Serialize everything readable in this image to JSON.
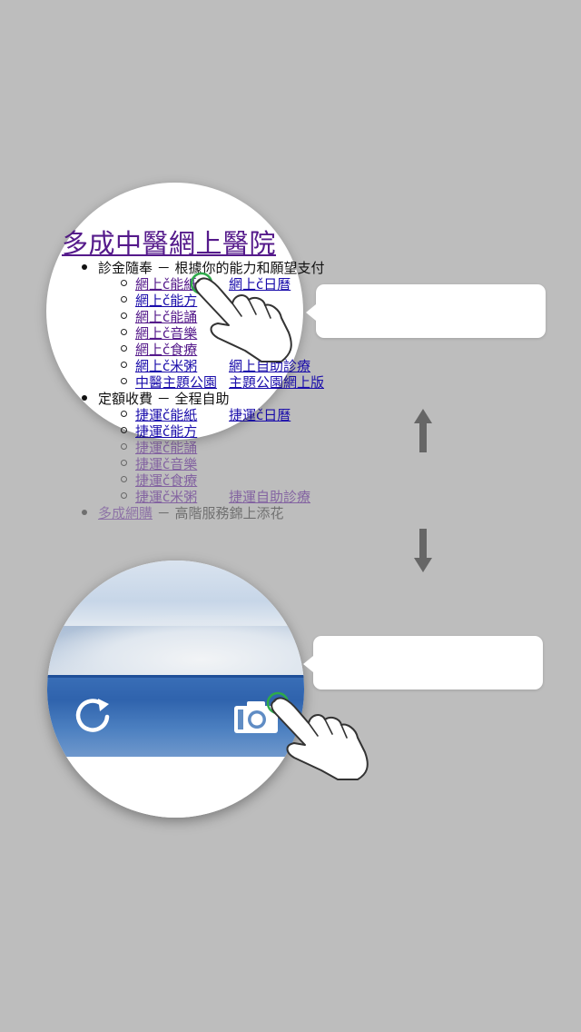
{
  "site": {
    "title": "多成中醫網上醫院"
  },
  "sections": [
    {
      "label": "診金隨奉 － 根據你的能力和願望支付",
      "rows": [
        {
          "left": "網上č能紙",
          "right": "網上č日曆"
        },
        {
          "left": "網上č能方",
          "right": ""
        },
        {
          "left": "網上č能誦",
          "right": ""
        },
        {
          "left": "網上č音樂",
          "right": ""
        },
        {
          "left": "網上č食療",
          "right": ""
        },
        {
          "left": "網上č米粥",
          "right": "網上自助診療"
        },
        {
          "left": "中醫主題公園",
          "right": "主題公園網上版"
        }
      ]
    },
    {
      "label": "定額收費 － 全程自助",
      "rows": [
        {
          "left": "捷運č能紙",
          "right": "捷運č日曆"
        },
        {
          "left": "捷運č能方",
          "right": ""
        },
        {
          "left": "捷運č能誦",
          "right": ""
        },
        {
          "left": "捷運č音樂",
          "right": ""
        },
        {
          "left": "捷運č食療",
          "right": ""
        },
        {
          "left": "捷運č米粥",
          "right": "捷運自助診療"
        }
      ]
    }
  ],
  "footer_item": {
    "link": "多成網購",
    "text": " － 高階服務錦上添花"
  },
  "tooltips": {
    "top": "",
    "bottom": ""
  },
  "icons": {
    "refresh": "refresh-icon",
    "camera": "camera-icon",
    "hand_top": "tap-hand-icon",
    "hand_bottom": "tap-hand-icon",
    "arrow_up": "arrow-up-icon",
    "arrow_down": "arrow-down-icon"
  },
  "colors": {
    "background": "#bdbdbd",
    "tap_ring": "#2eaa4a",
    "visited_link": "#551a8b",
    "link": "#1a0dab",
    "arrow": "#666666"
  }
}
